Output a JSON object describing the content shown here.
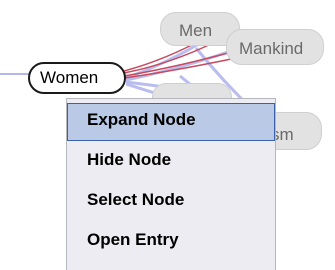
{
  "graph": {
    "nodes": {
      "women": "Women",
      "men": "Men",
      "mankind": "Mankind",
      "ism": "sm"
    }
  },
  "context_menu": {
    "items": [
      {
        "label": "Expand Node",
        "highlighted": true
      },
      {
        "label": "Hide Node",
        "highlighted": false
      },
      {
        "label": "Select Node",
        "highlighted": false
      },
      {
        "label": "Open Entry",
        "highlighted": false
      }
    ]
  },
  "colors": {
    "edge_active": "#c84a5e",
    "edge_passive": "#b8bcef",
    "menu_highlight": "#b9c9e6",
    "menu_highlight_border": "#3b62a8"
  }
}
